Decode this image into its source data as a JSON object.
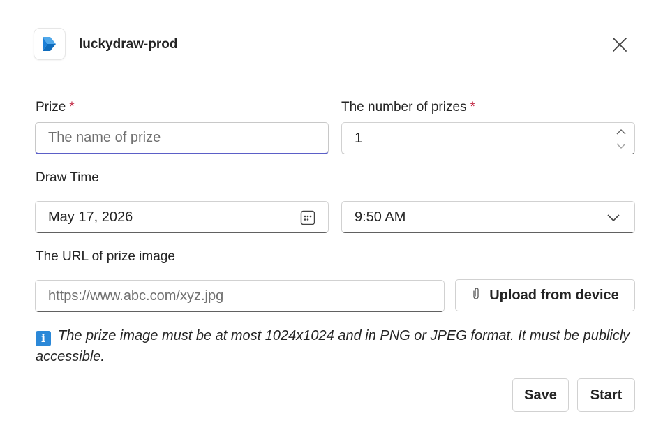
{
  "header": {
    "app_name": "luckydraw-prod",
    "brand_color": "#0f6cbd",
    "close_icon": "close-icon"
  },
  "form": {
    "prize": {
      "label": "Prize",
      "required_mark": "*",
      "value": "",
      "placeholder": "The name of prize"
    },
    "count": {
      "label": "The number of prizes",
      "required_mark": "*",
      "value": "1"
    },
    "draw_time": {
      "label": "Draw Time",
      "date": "May 17, 2026",
      "time": "9:50 AM"
    },
    "image_url": {
      "label": "The URL of prize image",
      "value": "",
      "placeholder": "https://www.abc.com/xyz.jpg",
      "upload_label": "Upload from device"
    },
    "info_text": "The prize image must be at most 1024x1024 and in PNG or JPEG format. It must be publicly accessible."
  },
  "actions": {
    "save_label": "Save",
    "start_label": "Start"
  },
  "colors": {
    "focus": "#5b5fc7",
    "required": "#c4314b",
    "info": "#2b88d8"
  }
}
